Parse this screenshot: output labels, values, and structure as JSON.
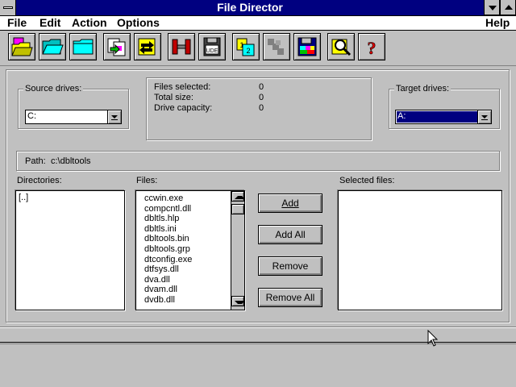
{
  "window": {
    "title": "File Director"
  },
  "menu": {
    "file": "File",
    "edit": "Edit",
    "action": "Action",
    "options": "Options",
    "help": "Help"
  },
  "toolbar": {
    "icons": [
      "open-folder-pink-icon",
      "open-folder-icon",
      "folder-icon",
      "copy-files-icon",
      "move-files-icon",
      "compress-icon",
      "ude-disk-icon",
      "diskette-copy-icon",
      "disabled-chain-icon",
      "defrag-disk-icon",
      "find-file-icon",
      "help-icon"
    ]
  },
  "info": {
    "files_selected_label": "Files selected:",
    "files_selected_value": "0",
    "total_size_label": "Total size:",
    "total_size_value": "0",
    "drive_capacity_label": "Drive capacity:",
    "drive_capacity_value": "0"
  },
  "source": {
    "label": "Source drives:",
    "value": "C:"
  },
  "target": {
    "label": "Target drives:",
    "value": "A:"
  },
  "path": {
    "label": "Path:",
    "value": "c:\\dbltools"
  },
  "directories": {
    "label": "Directories:",
    "items": [
      "[..]"
    ]
  },
  "files": {
    "label": "Files:",
    "items": [
      "ccwin.exe",
      "compcntl.dll",
      "dbltls.hlp",
      "dbltls.ini",
      "dbltools.bin",
      "dbltools.grp",
      "dtconfig.exe",
      "dtfsys.dll",
      "dva.dll",
      "dvam.dll",
      "dvdb.dll"
    ]
  },
  "selected": {
    "label": "Selected files:"
  },
  "buttons": {
    "add": "Add",
    "add_all": "Add All",
    "remove": "Remove",
    "remove_all": "Remove All"
  },
  "colors": {
    "titlebar": "#000080",
    "window": "#c0c0c0",
    "highlight": "#000080"
  }
}
